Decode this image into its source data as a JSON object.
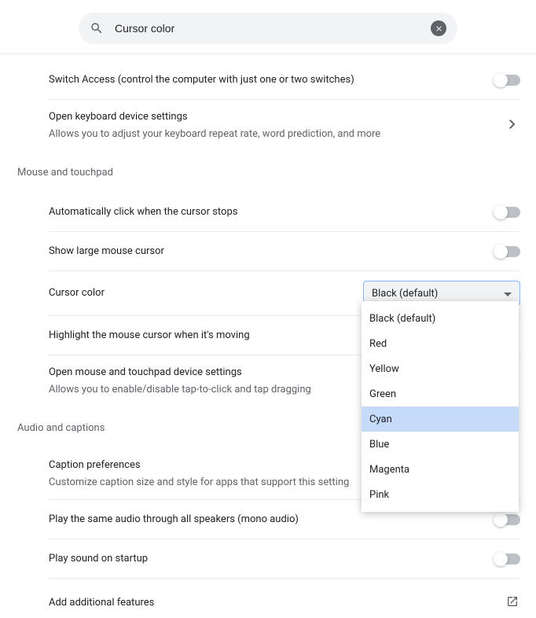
{
  "search": {
    "value": "Cursor color"
  },
  "rows": {
    "switchAccess": "Switch Access (control the computer with just one or two switches)",
    "keyboardSettingsTitle": "Open keyboard device settings",
    "keyboardSettingsSub": "Allows you to adjust your keyboard repeat rate, word prediction, and more",
    "autoClick": "Automatically click when the cursor stops",
    "largeCursor": "Show large mouse cursor",
    "cursorColor": "Cursor color",
    "highlightCursor": "Highlight the mouse cursor when it's moving",
    "mouseSettingsTitle": "Open mouse and touchpad device settings",
    "mouseSettingsSub": "Allows you to enable/disable tap-to-click and tap dragging",
    "captionTitle": "Caption preferences",
    "captionSub": "Customize caption size and style for apps that support this setting",
    "monoAudio": "Play the same audio through all speakers (mono audio)",
    "startupSound": "Play sound on startup",
    "addFeatures": "Add additional features"
  },
  "sections": {
    "mouse": "Mouse and touchpad",
    "audio": "Audio and captions"
  },
  "dropdown": {
    "selected": "Black (default)",
    "options": {
      "o0": "Black (default)",
      "o1": "Red",
      "o2": "Yellow",
      "o3": "Green",
      "o4": "Cyan",
      "o5": "Blue",
      "o6": "Magenta",
      "o7": "Pink"
    }
  }
}
